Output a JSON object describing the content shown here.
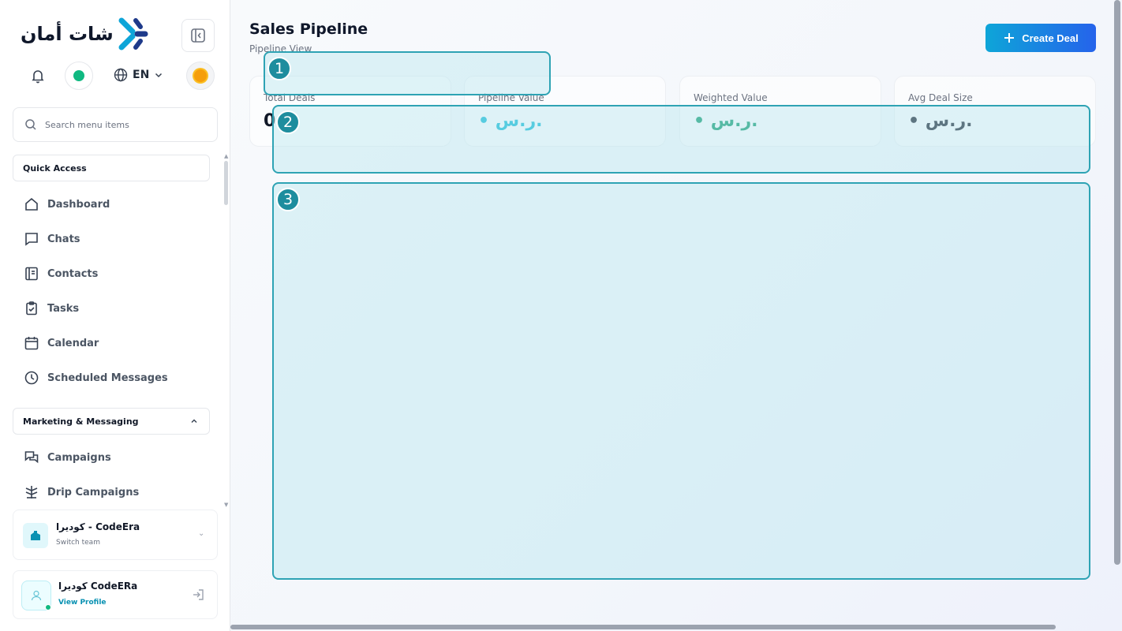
{
  "sidebar": {
    "logo_text": "شات أمان",
    "language": "EN",
    "search_placeholder": "Search menu items",
    "quick_access_label": "Quick Access",
    "quick_items": [
      "Dashboard",
      "Chats",
      "Contacts",
      "Tasks",
      "Calendar",
      "Scheduled Messages"
    ],
    "marketing_label": "Marketing & Messaging",
    "marketing_items": [
      "Campaigns",
      "Drip Campaigns"
    ],
    "team": {
      "name": "كوديرا - CodeEra",
      "sub": "Switch team"
    },
    "profile": {
      "name": "كوديرا CodeERa",
      "link": "View Profile"
    }
  },
  "header": {
    "title": "Sales Pipeline",
    "subtitle": "Pipeline View",
    "create_label": "Create Deal"
  },
  "stats": [
    {
      "label": "Total Deals",
      "value": "0",
      "color": "#111827"
    },
    {
      "label": "Pipeline Value",
      "value": "• ر.س.",
      "color": "#06b6d4"
    },
    {
      "label": "Weighted Value",
      "value": "• ر.س.",
      "color": "#059669"
    },
    {
      "label": "Avg Deal Size",
      "value": "• ر.س.",
      "color": "#111827"
    }
  ],
  "overlays": [
    "1",
    "2",
    "3"
  ],
  "colors": {
    "accent": "#0ea5d8",
    "overlay_border": "#2ea3b4",
    "badge": "#1e8d9e"
  }
}
